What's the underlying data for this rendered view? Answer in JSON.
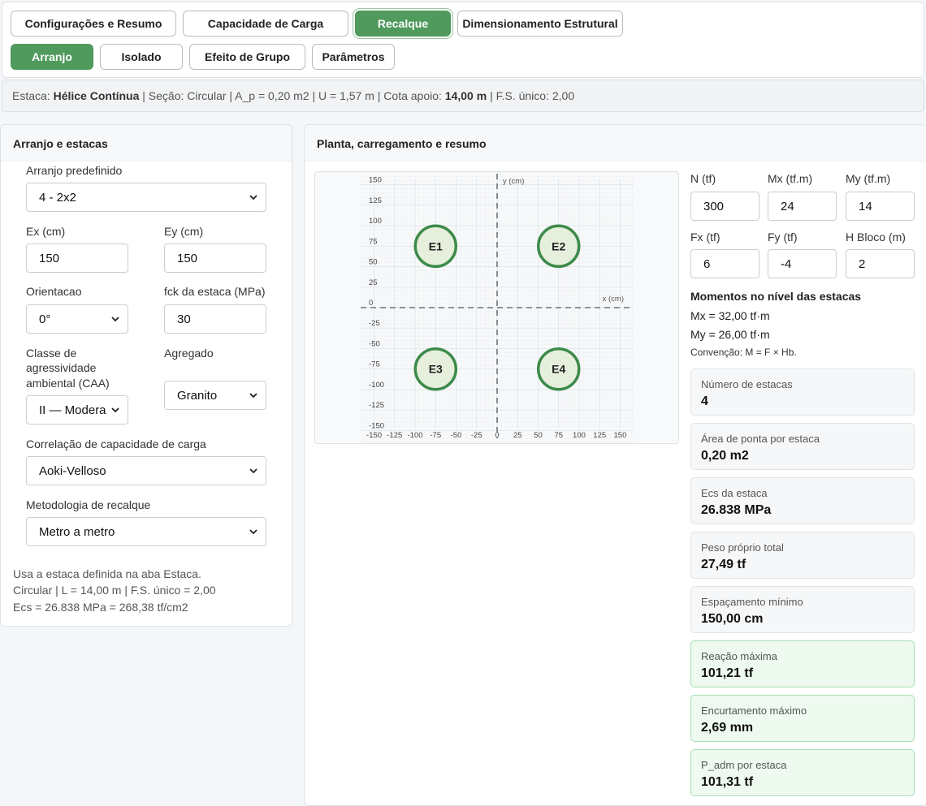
{
  "tabs": {
    "main": [
      "Configurações e Resumo",
      "Capacidade de Carga",
      "Recalque",
      "Dimensionamento Estrutural"
    ],
    "sub": [
      "Arranjo",
      "Isolado",
      "Efeito de Grupo",
      "Parâmetros"
    ]
  },
  "info": {
    "estaca_label": "Estaca:",
    "estaca": "Hélice Contínua",
    "secao": "| Seção: Circular | A_p = 0,20 m2 | U = 1,57 m | Cota apoio:",
    "cota": "14,00 m",
    "fs": "| F.S. único: 2,00"
  },
  "left": {
    "title": "Arranjo e estacas",
    "arranjo_label": "Arranjo predefinido",
    "arranjo_value": "4 - 2x2",
    "ex_label": "Ex (cm)",
    "ex_value": "150",
    "ey_label": "Ey (cm)",
    "ey_value": "150",
    "orient_label": "Orientacao",
    "orient_value": "0°",
    "fck_label": "fck da estaca (MPa)",
    "fck_value": "30",
    "caa_label_1": "Classe de",
    "caa_label_2": "agressividade",
    "caa_label_3": "ambiental (CAA)",
    "caa_value": "II — Modera",
    "agregado_label": "Agregado",
    "agregado_value": "Granito",
    "correl_label": "Correlação de capacidade de carga",
    "correl_value": "Aoki-Velloso",
    "metodo_label": "Metodologia de recalque",
    "metodo_value": "Metro a metro",
    "note_1": "Usa a estaca definida na aba Estaca.",
    "note_2": "Circular | L = 14,00 m | F.S. único = 2,00",
    "note_3": "Ecs = 26.838 MPa = 268,38 tf/cm2"
  },
  "right": {
    "title": "Planta, carregamento e resumo",
    "plot": {
      "x_label": "x (cm)",
      "y_label": "y (cm)",
      "x_ticks": [
        "-150",
        "-125",
        "-100",
        "-75",
        "-50",
        "-25",
        "0",
        "25",
        "50",
        "75",
        "100",
        "125",
        "150"
      ],
      "y_ticks": [
        "150",
        "125",
        "100",
        "75",
        "50",
        "25",
        "0",
        "-25",
        "-50",
        "-75",
        "-100",
        "-125",
        "-150"
      ],
      "piles": [
        {
          "name": "E1",
          "x": -75,
          "y": 75
        },
        {
          "name": "E2",
          "x": 75,
          "y": 75
        },
        {
          "name": "E3",
          "x": -75,
          "y": -75
        },
        {
          "name": "E4",
          "x": 75,
          "y": -75
        }
      ],
      "colors": {
        "pile_stroke": "#3d8a4a",
        "pile_fill": "#e6efdc",
        "grid": "#dde3ea",
        "axis": "#6b737b"
      }
    },
    "loads": {
      "n_label": "N (tf)",
      "n_value": "300",
      "mx_label": "Mx (tf.m)",
      "mx_value": "24",
      "my_label": "My (tf.m)",
      "my_value": "14",
      "fx_label": "Fx (tf)",
      "fx_value": "6",
      "fy_label": "Fy (tf)",
      "fy_value": "-4",
      "h_label": "H Bloco (m)",
      "h_value": "2"
    },
    "moments": {
      "title": "Momentos no nível das estacas",
      "mx": "Mx = 32,00 tf·m",
      "my": "My = 26,00 tf·m",
      "conv": "Convenção: M = F × Hb."
    },
    "cards": [
      {
        "title": "Número de estacas",
        "value": "4"
      },
      {
        "title": "Área de ponta por estaca",
        "value": "0,20 m2"
      },
      {
        "title": "Ecs da estaca",
        "value": "26.838 MPa"
      },
      {
        "title": "Peso próprio total",
        "value": "27,49 tf"
      },
      {
        "title": "Espaçamento mínimo",
        "value": "150,00 cm"
      },
      {
        "title": "Reação máxima",
        "value": "101,21 tf"
      },
      {
        "title": "Encurtamento máximo",
        "value": "2,69 mm"
      },
      {
        "title": "P_adm por estaca",
        "value": "101,31 tf"
      }
    ]
  }
}
